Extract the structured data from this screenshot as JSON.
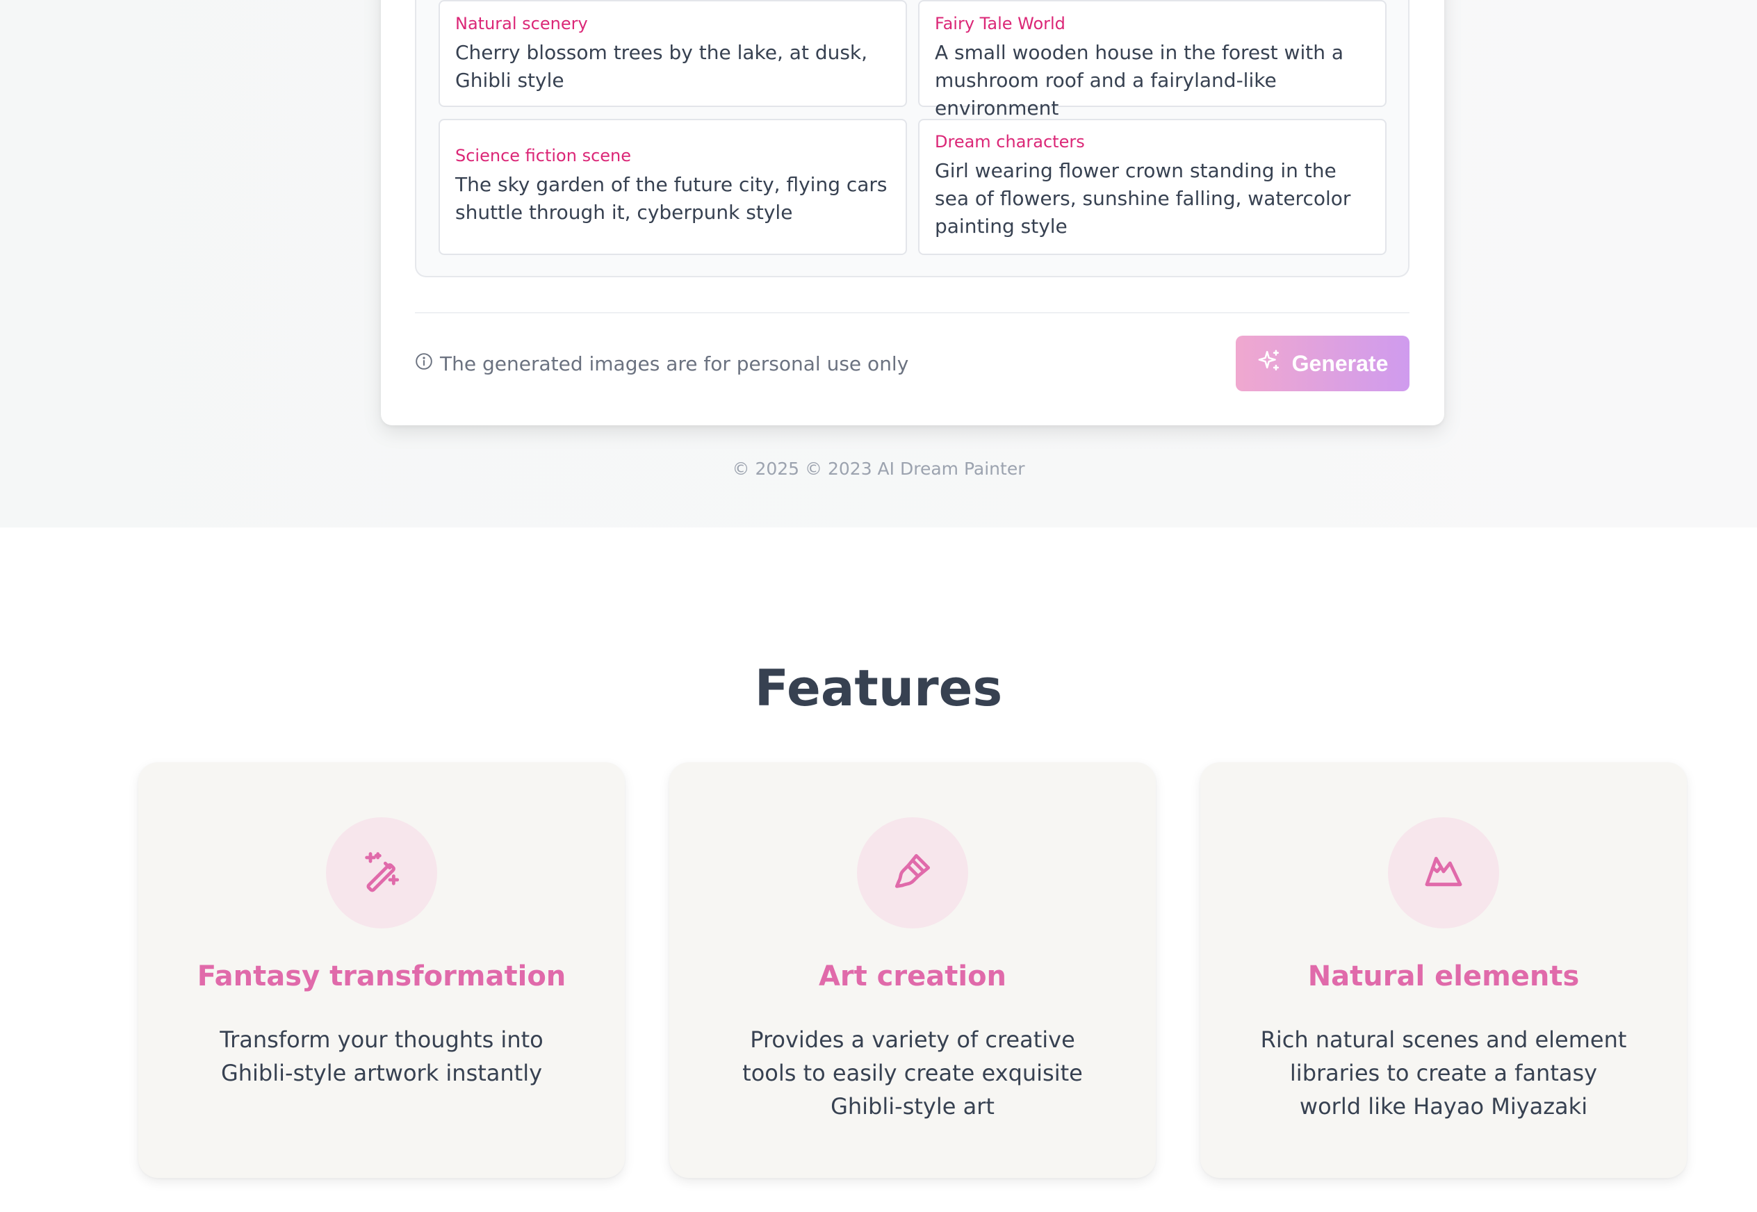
{
  "examples": [
    {
      "category": "Natural scenery",
      "text": "Cherry blossom trees by the lake, at dusk, Ghibli style"
    },
    {
      "category": "Fairy Tale World",
      "text": "A small wooden house in the forest with a mushroom roof and a fairyland-like environment"
    },
    {
      "category": "Science fiction scene",
      "text": "The sky garden of the future city, flying cars shuttle through it, cyberpunk style"
    },
    {
      "category": "Dream characters",
      "text": "Girl wearing flower crown standing in the sea of flowers, sunshine falling, watercolor painting style"
    }
  ],
  "notice": {
    "icon": "info-icon",
    "text": "The generated images are for personal use only"
  },
  "generate_button": {
    "icon": "sparkles-icon",
    "label": "Generate"
  },
  "footer": {
    "text": "© 2025 © 2023 AI Dream Painter"
  },
  "features": {
    "title": "Features",
    "items": [
      {
        "icon": "magic-wand-icon",
        "title": "Fantasy transformation",
        "description": "Transform your thoughts into Ghibli-style artwork instantly"
      },
      {
        "icon": "paintbrush-icon",
        "title": "Art creation",
        "description": "Provides a variety of creative tools to easily create exquisite Ghibli-style art"
      },
      {
        "icon": "mountain-icon",
        "title": "Natural elements",
        "description": "Rich natural scenes and element libraries to create a fantasy world like Hayao Miyazaki"
      }
    ]
  },
  "colors": {
    "accent": "#db2777",
    "feature_title": "#e06aaa",
    "button_start": "#f0a8cf",
    "button_end": "#cf9bee"
  }
}
